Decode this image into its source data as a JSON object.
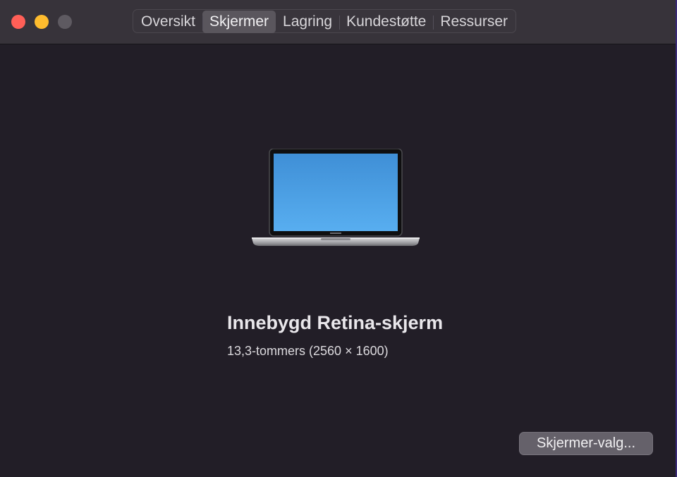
{
  "window": {
    "controls": [
      "close-icon",
      "minimize-icon",
      "zoom-icon"
    ],
    "colors": {
      "close": "#ff5f57",
      "minimize": "#febc2e",
      "zoom": "#5e5a61",
      "screen": "#4a9fe3"
    }
  },
  "tabs": [
    {
      "label": "Oversikt",
      "active": false
    },
    {
      "label": "Skjermer",
      "active": true
    },
    {
      "label": "Lagring",
      "active": false
    },
    {
      "label": "Kundestøtte",
      "active": false
    },
    {
      "label": "Ressurser",
      "active": false
    }
  ],
  "display": {
    "icon": "macbook-pro-icon",
    "name": "Innebygd Retina-skjerm",
    "spec": "13,3-tommers (2560 × 1600)"
  },
  "actions": {
    "display_settings_label": "Skjermer-valg..."
  }
}
